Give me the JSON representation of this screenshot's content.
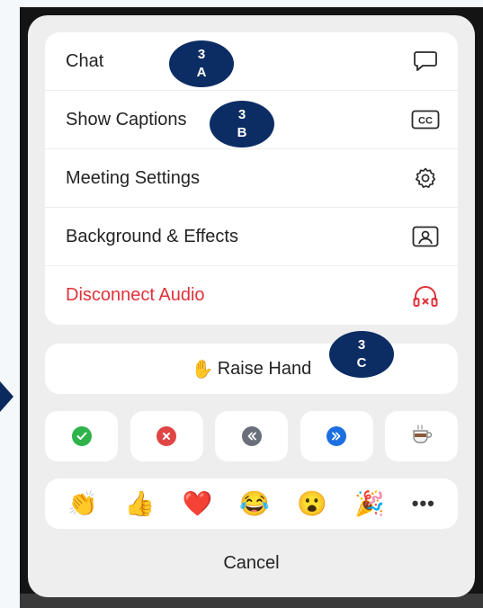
{
  "menu": {
    "items": [
      {
        "label": "Chat",
        "icon": "chat-bubble-icon"
      },
      {
        "label": "Show Captions",
        "icon": "cc-icon"
      },
      {
        "label": "Meeting Settings",
        "icon": "gear-icon"
      },
      {
        "label": "Background & Effects",
        "icon": "portrait-icon"
      },
      {
        "label": "Disconnect Audio",
        "icon": "headphones-x-icon",
        "color": "#e0323a"
      }
    ]
  },
  "raise_hand": {
    "emoji": "✋",
    "label": "Raise Hand"
  },
  "status_buttons": [
    {
      "icon": "yes-check-icon",
      "color": "#2fb34a"
    },
    {
      "icon": "no-x-icon",
      "color": "#e04545"
    },
    {
      "icon": "slower-icon",
      "color": "#6b6f7a"
    },
    {
      "icon": "faster-icon",
      "color": "#1d6fe0"
    },
    {
      "icon": "coffee-icon"
    }
  ],
  "reactions": [
    "👏",
    "👍",
    "❤️",
    "😂",
    "😮",
    "🎉"
  ],
  "more_label": "•••",
  "cancel_label": "Cancel",
  "callouts": [
    {
      "number": "3",
      "letter": "A"
    },
    {
      "number": "3",
      "letter": "B"
    },
    {
      "number": "3",
      "letter": "C"
    }
  ]
}
